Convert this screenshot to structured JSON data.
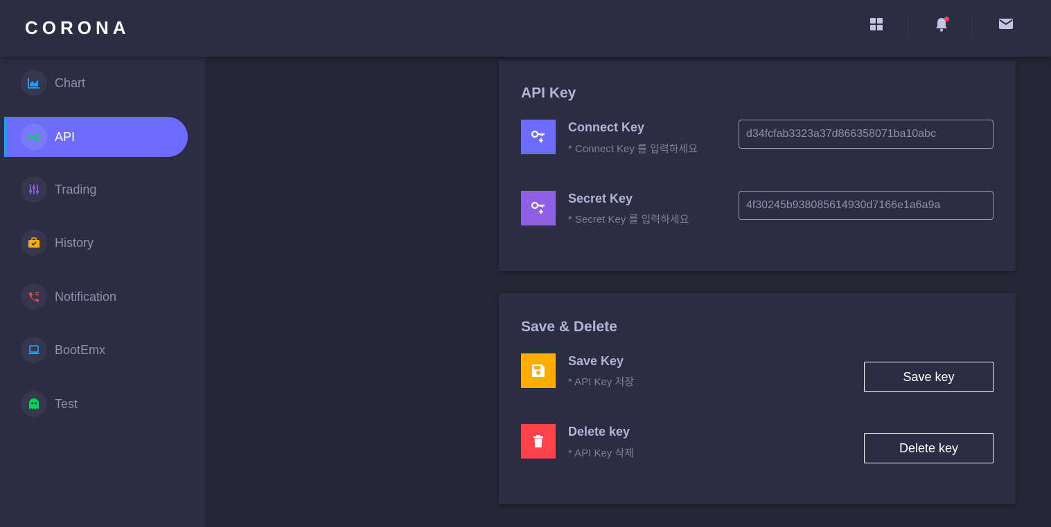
{
  "brand": {
    "title": "CORONA"
  },
  "header": {
    "icons": [
      "grid-icon",
      "bell-icon",
      "mail-icon"
    ],
    "notification_dot_color": "#fc424a"
  },
  "sidebar": {
    "items": [
      {
        "label": "Chart",
        "icon": "chart-icon",
        "icon_color": "#1c9cf5",
        "active": false
      },
      {
        "label": "API",
        "icon": "api-icon",
        "icon_color": "#00d25b",
        "active": true
      },
      {
        "label": "Trading",
        "icon": "sliders-icon",
        "icon_color": "#8f5fe8",
        "active": false
      },
      {
        "label": "History",
        "icon": "briefcase-icon",
        "icon_color": "#ffab00",
        "active": false
      },
      {
        "label": "Notification",
        "icon": "phone-icon",
        "icon_color": "#fc424a",
        "active": false
      },
      {
        "label": "BootEmx",
        "icon": "laptop-icon",
        "icon_color": "#1c9cf5",
        "active": false
      },
      {
        "label": "Test",
        "icon": "ghost-icon",
        "icon_color": "#00d25b",
        "active": false
      }
    ],
    "active_color": "#6c6cff"
  },
  "api_card": {
    "title": "API Key",
    "connect": {
      "title": "Connect Key",
      "subtitle": "* Connect Key 를 입력하세요",
      "value": "d34fcfab3323a37d866358071ba10abc",
      "icon": "key-plus-icon",
      "icon_bg": "#6c6cff"
    },
    "secret": {
      "title": "Secret Key",
      "subtitle": "* Secret Key 를 입력하세요",
      "value": "4f30245b938085614930d7166e1a6a9a",
      "icon": "key-plus-icon",
      "icon_bg": "#8f5fe8"
    }
  },
  "save_card": {
    "title": "Save & Delete",
    "save": {
      "title": "Save Key",
      "subtitle": "* API Key 저장",
      "button": "Save key",
      "icon": "floppy-icon",
      "icon_bg": "#ffab00"
    },
    "delete": {
      "title": "Delete key",
      "subtitle": "* API Key 삭제",
      "button": "Delete key",
      "icon": "trash-icon",
      "icon_bg": "#fc424a"
    }
  }
}
